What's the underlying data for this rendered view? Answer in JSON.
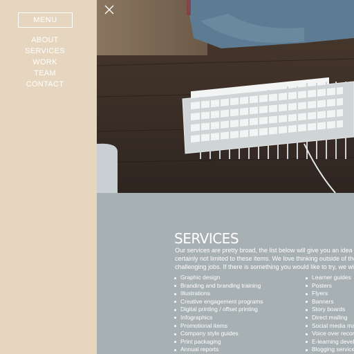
{
  "sidebar": {
    "menu_label": "MENU",
    "nav": [
      "ABOUT",
      "SERVICES",
      "WORK",
      "TEAM",
      "CONTACT"
    ]
  },
  "hero": {
    "close_icon": "close-icon",
    "image": "photo-desk-keyboard-mouse"
  },
  "services": {
    "title": "SERVICES",
    "intro": [
      "Our services are pretty broad, the list below will give you an idea of  wha",
      "certainly not limited to these items. We love thinking outside of the box a",
      "challenging jobs. If there is something you would like to try, we will do ou"
    ],
    "list_left": [
      "Graphic design",
      "Branding and branding training",
      "Illustrations",
      "Creative engagement programs",
      "Digital printing / offset printing",
      "Infographics",
      "Promotional items",
      "Company style guides",
      "Print packaging",
      "Annual reports"
    ],
    "list_right": [
      "Learner guides",
      "Posters",
      "Flyers",
      "Banners",
      "Story boards",
      "Direct mailing",
      "Social media mar",
      "Voice over recor",
      "E-learning develo",
      "Blogging services"
    ]
  },
  "colors": {
    "sidebar_bg": "#e6d6bf",
    "services_bg": "#a7b0b2",
    "text": "#ffffff"
  }
}
